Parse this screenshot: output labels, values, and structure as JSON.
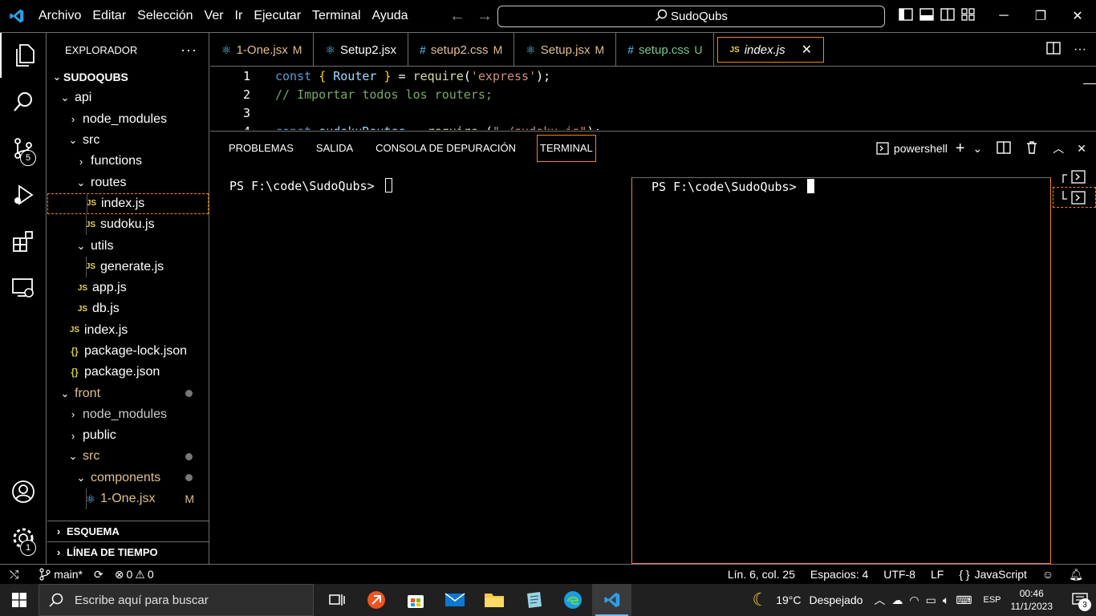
{
  "titlebar": {
    "menu": [
      "Archivo",
      "Editar",
      "Selección",
      "Ver",
      "Ir",
      "Ejecutar",
      "Terminal",
      "Ayuda"
    ],
    "search_text": "SudoQubs",
    "icons": [
      "vscode-logo",
      "arrow-left-icon",
      "arrow-right-icon",
      "search-icon",
      "toggle-sidebar-icon",
      "toggle-panel-icon",
      "toggle-secondary-sidebar-icon",
      "customize-layout-icon",
      "minimize-icon",
      "restore-icon",
      "close-icon"
    ]
  },
  "activitybar": {
    "items": [
      "explorer-icon",
      "search-icon",
      "source-control-icon",
      "run-debug-icon",
      "extensions-icon",
      "remote-explorer-icon"
    ],
    "scm_badge": "5",
    "bottom": [
      "accounts-icon",
      "manage-icon"
    ],
    "manage_badge": "1"
  },
  "sidebar": {
    "title": "EXPLORADOR",
    "more": "···",
    "root": "SUDOQUBS",
    "tree": [
      {
        "label": "api",
        "type": "folder-open",
        "depth": 1
      },
      {
        "label": "node_modules",
        "type": "folder-closed",
        "depth": 2
      },
      {
        "label": "src",
        "type": "folder-open",
        "depth": 2
      },
      {
        "label": "functions",
        "type": "folder-closed",
        "depth": 3
      },
      {
        "label": "routes",
        "type": "folder-open",
        "depth": 3
      },
      {
        "label": "index.js",
        "type": "js",
        "depth": 4,
        "selected": true
      },
      {
        "label": "sudoku.js",
        "type": "js",
        "depth": 4
      },
      {
        "label": "utils",
        "type": "folder-open",
        "depth": 3
      },
      {
        "label": "generate.js",
        "type": "js",
        "depth": 4
      },
      {
        "label": "app.js",
        "type": "js",
        "depth": 3
      },
      {
        "label": "db.js",
        "type": "js",
        "depth": 3
      },
      {
        "label": "index.js",
        "type": "js",
        "depth": 2
      },
      {
        "label": "package-lock.json",
        "type": "json",
        "depth": 2
      },
      {
        "label": "package.json",
        "type": "json",
        "depth": 2
      },
      {
        "label": "front",
        "type": "folder-open",
        "depth": 1,
        "status": "dot",
        "color": "front"
      },
      {
        "label": "node_modules",
        "type": "folder-closed",
        "depth": 2,
        "color": "muted"
      },
      {
        "label": "public",
        "type": "folder-closed",
        "depth": 2
      },
      {
        "label": "src",
        "type": "folder-open",
        "depth": 2,
        "status": "dot",
        "color": "front"
      },
      {
        "label": "components",
        "type": "folder-open",
        "depth": 3,
        "status": "dot",
        "color": "front"
      },
      {
        "label": "1-One.jsx",
        "type": "react",
        "depth": 4,
        "status": "M",
        "color": "front"
      }
    ],
    "outline": "ESQUEMA",
    "timeline": "LÍNEA DE TIEMPO"
  },
  "tabs": [
    {
      "label": "1-One.jsx",
      "icon": "react",
      "flag": "M",
      "state": "modified"
    },
    {
      "label": "Setup2.jsx",
      "icon": "react",
      "flag": "",
      "state": "normal"
    },
    {
      "label": "setup2.css",
      "icon": "css",
      "flag": "M",
      "state": "modified"
    },
    {
      "label": "Setup.jsx",
      "icon": "react",
      "flag": "M",
      "state": "modified"
    },
    {
      "label": "setup.css",
      "icon": "css",
      "flag": "U",
      "state": "untracked"
    },
    {
      "label": "index.js",
      "icon": "js",
      "flag": "",
      "state": "active"
    }
  ],
  "editor": {
    "lines": [
      {
        "n": "1",
        "tokens": [
          [
            "kw",
            "const "
          ],
          [
            "br",
            "{ "
          ],
          [
            "var",
            "Router"
          ],
          [
            "br",
            " }"
          ],
          [
            "",
            " = "
          ],
          [
            "fn",
            "require"
          ],
          [
            "",
            "("
          ],
          [
            "str",
            "'express'"
          ],
          [
            "",
            ");"
          ]
        ]
      },
      {
        "n": "2",
        "tokens": [
          [
            "cmt",
            "// Importar todos los routers;"
          ]
        ]
      },
      {
        "n": "3",
        "tokens": []
      },
      {
        "n": "4",
        "tokens": [
          [
            "kw",
            "const "
          ],
          [
            "var",
            "sudokuRoutes"
          ],
          [
            "",
            " = "
          ],
          [
            "fn",
            "require"
          ],
          [
            "",
            " ("
          ],
          [
            "str",
            "\"./sudoku.js\""
          ],
          [
            "",
            ");"
          ]
        ]
      }
    ]
  },
  "panel": {
    "tabs": [
      "PROBLEMAS",
      "SALIDA",
      "CONSOLA DE DEPURACIÓN",
      "TERMINAL"
    ],
    "active_tab": "TERMINAL",
    "shell": "powershell",
    "prompt_left": "PS F:\\code\\SudoQubs> ",
    "prompt_right": "PS F:\\code\\SudoQubs> "
  },
  "statusbar": {
    "branch": "main*",
    "errors": "0",
    "warnings": "0",
    "position": "Lín. 6, col. 25",
    "spaces": "Espacios: 4",
    "encoding": "UTF-8",
    "eol": "LF",
    "language_brace": "{ }",
    "language": "JavaScript"
  },
  "taskbar": {
    "search_placeholder": "Escribe aquí para buscar",
    "apps": [
      "task-view-icon",
      "brave-like-icon",
      "store-icon",
      "mail-icon",
      "file-explorer-icon",
      "notepad-icon",
      "edge-icon",
      "vscode-icon"
    ],
    "temperature": "19°C",
    "weather": "Despejado",
    "language": "ESP",
    "time": "00:46",
    "date": "11/1/2023",
    "notifications": "3"
  },
  "colors": {
    "border": "#6f6f6f",
    "focus": "#f38518",
    "modified": "#e2c08d",
    "untracked": "#73c991",
    "keyword": "#569cd6",
    "string": "#ce9178",
    "comment": "#7ca668"
  }
}
